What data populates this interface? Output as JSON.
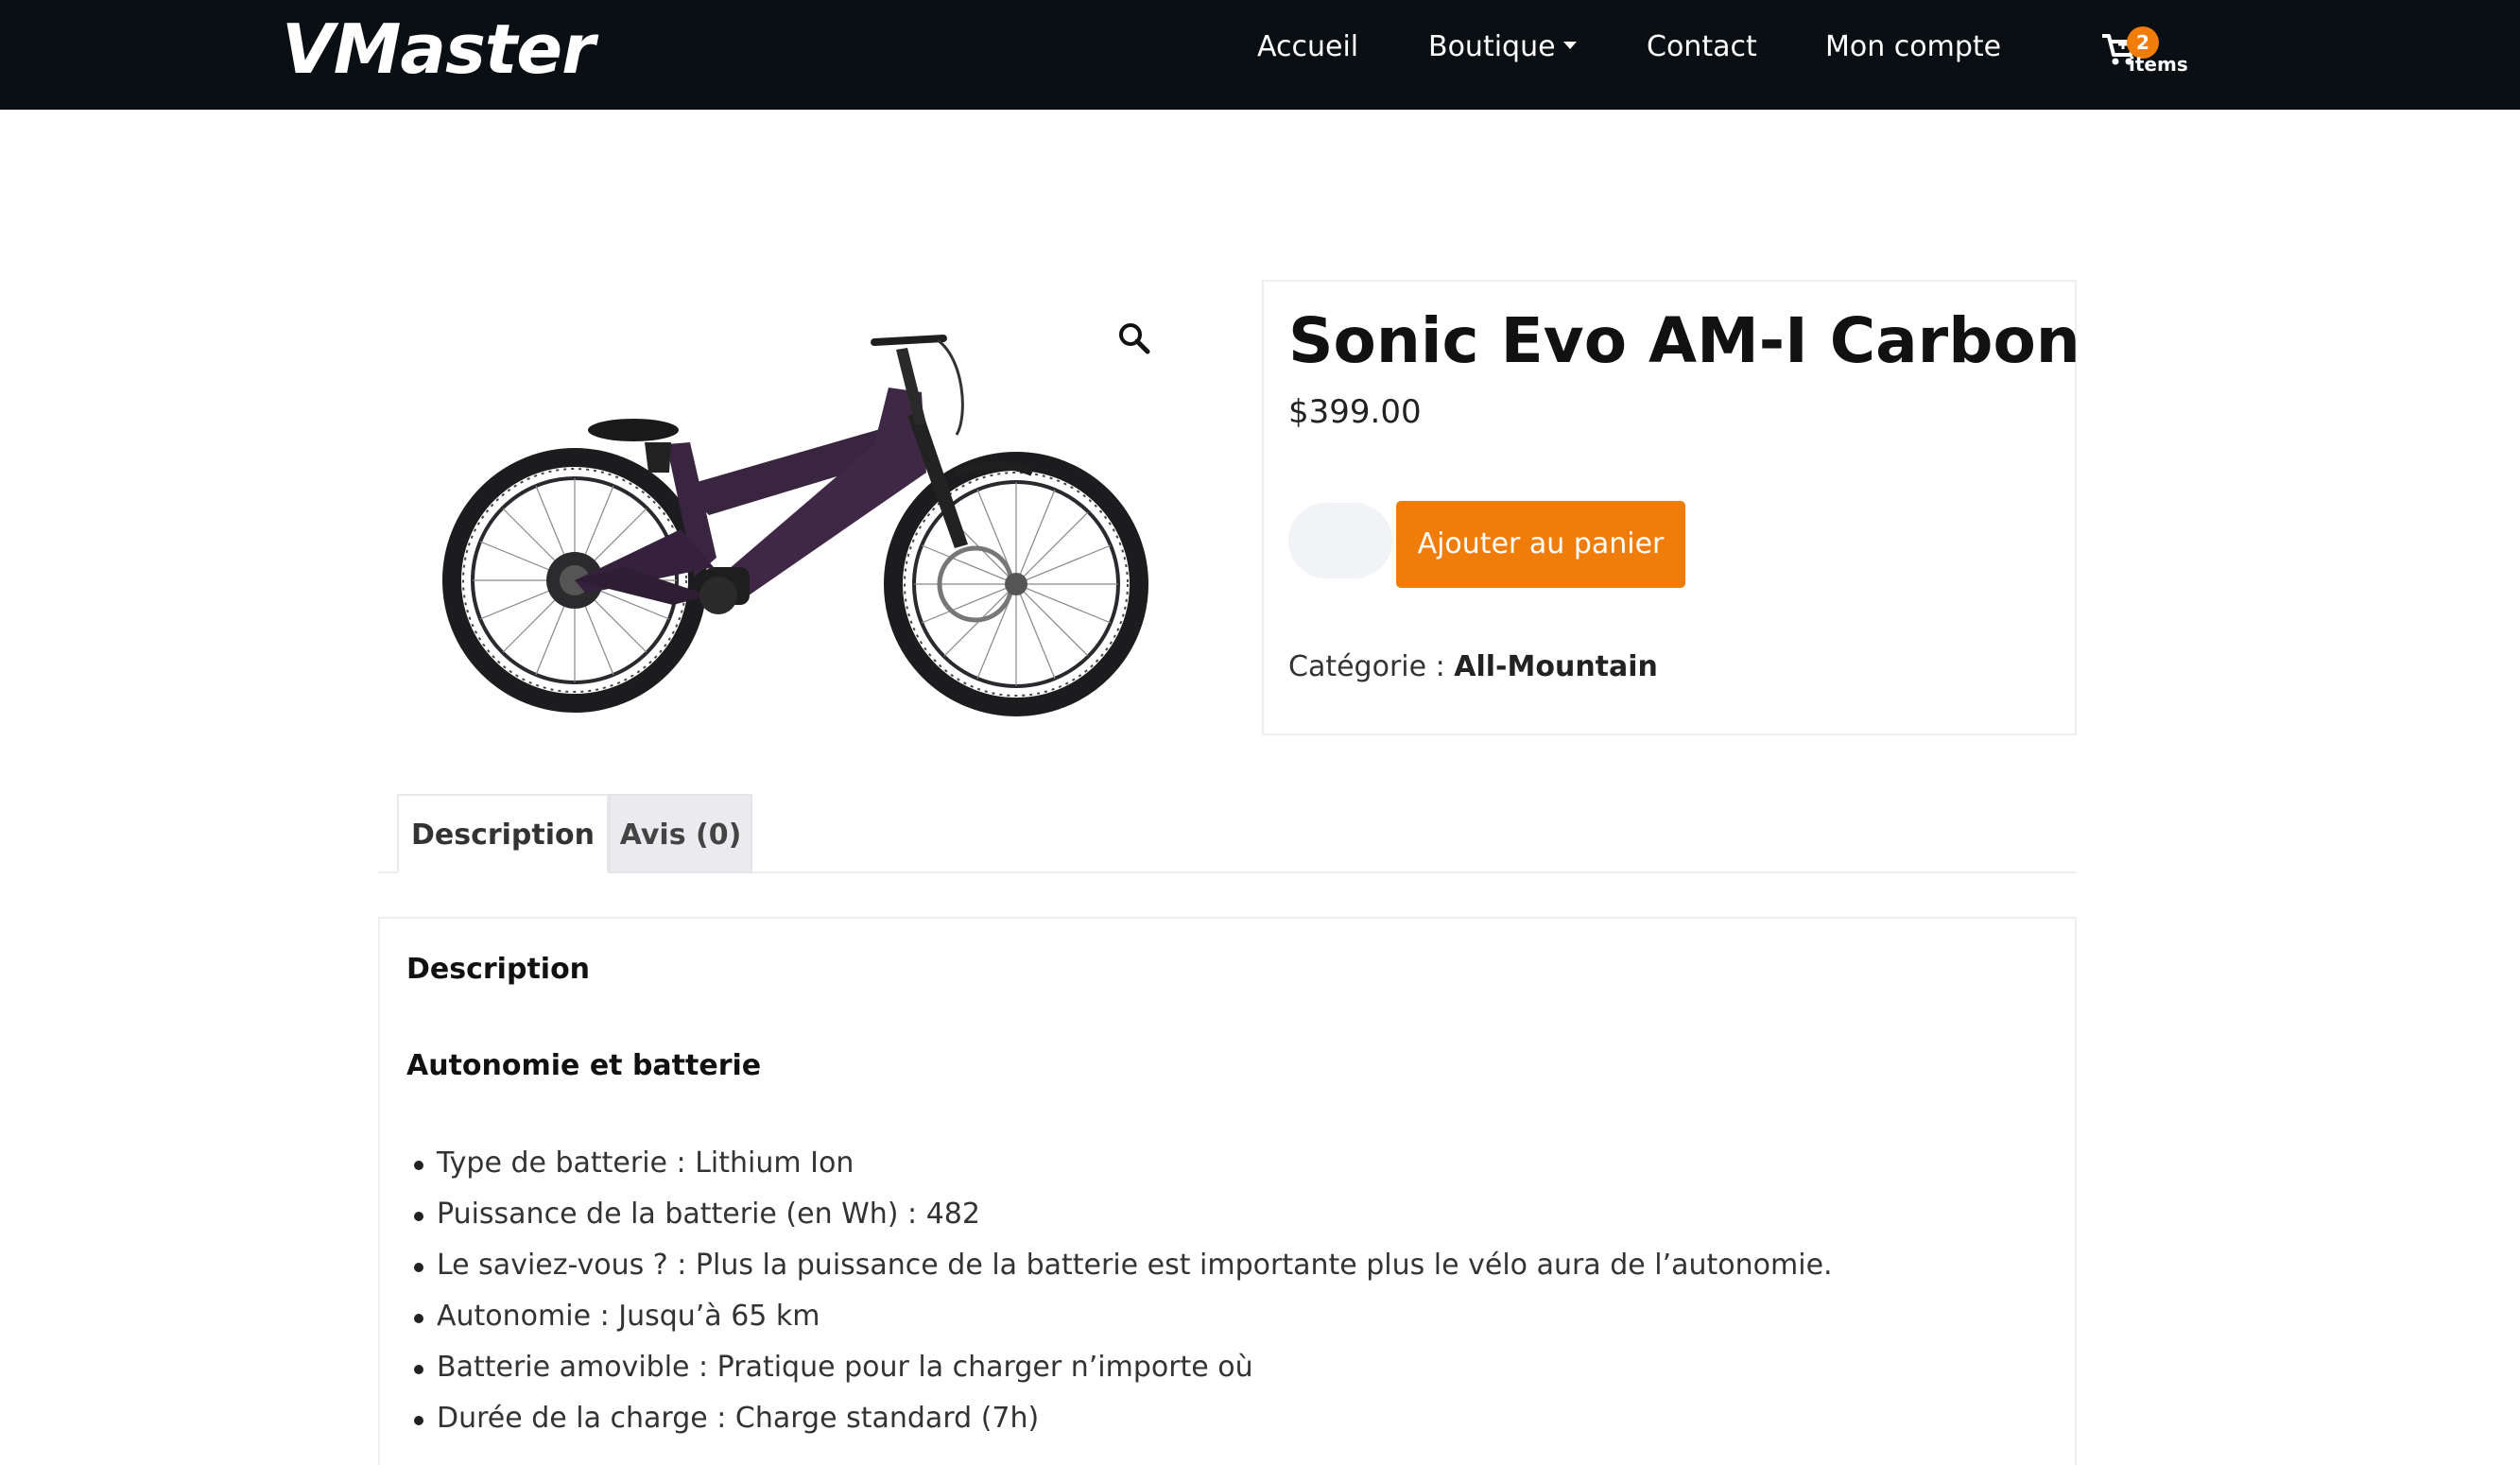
{
  "header": {
    "logo": "VMaster",
    "nav": {
      "home": "Accueil",
      "shop": "Boutique",
      "contact": "Contact",
      "account": "Mon compte"
    },
    "cart": {
      "count": "2",
      "label": "items",
      "icon": "cart-icon"
    }
  },
  "product": {
    "title": "Sonic Evo AM-I Carbon",
    "price": "$399.00",
    "add_to_cart_label": "Ajouter au panier",
    "category_label": "Catégorie :",
    "category_value": "All-Mountain",
    "zoom_icon": "magnifier-icon",
    "image_alt": "Vélo électrique tout-suspendu violet"
  },
  "tabs": {
    "description": "Description",
    "reviews": "Avis (0)"
  },
  "description": {
    "heading": "Description",
    "section_title": "Autonomie et batterie",
    "items": [
      "Type de batterie : Lithium Ion",
      "Puissance de la batterie (en Wh) : 482",
      "Le saviez-vous ? : Plus la puissance de la batterie est importante plus le vélo aura de l’autonomie.",
      "Autonomie : Jusqu’à 65 km",
      "Batterie amovible : Pratique pour la charger n’importe où",
      "Durée de la charge : Charge standard (7h)"
    ]
  },
  "colors": {
    "header_bg": "#0a0f14",
    "accent": "#f07c0a",
    "bike_frame": "#3a2540"
  }
}
